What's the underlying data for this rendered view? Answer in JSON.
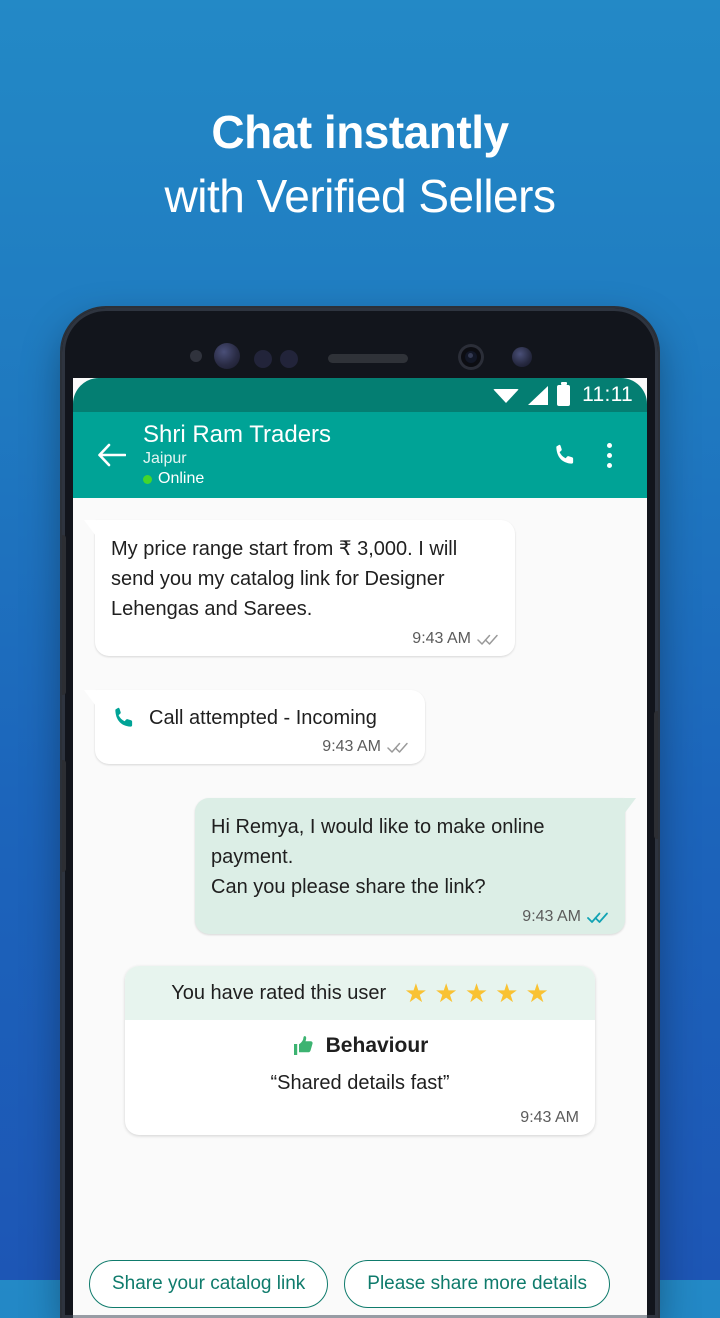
{
  "promo": {
    "headline_line1": "Chat instantly",
    "headline_line2": "with Verified Sellers",
    "background_top_color": "#2389c6",
    "background_bottom_color": "#1d56b5"
  },
  "phone": {
    "status_bar": {
      "time": "11:11",
      "icons": [
        "wifi-icon",
        "signal-icon",
        "battery-icon"
      ],
      "background_color": "#047e72"
    },
    "app_bar": {
      "back_icon": "arrow-left-icon",
      "contact_name": "Shri Ram Traders",
      "contact_location": "Jaipur",
      "presence_status": "Online",
      "presence_color": "#44d62c",
      "call_icon": "phone-icon",
      "overflow_icon": "more-vertical-icon",
      "background_color": "#00a396"
    },
    "chat": {
      "messages": [
        {
          "id": "msg-price-range",
          "direction": "incoming",
          "text": "My price range start from ₹ 3,000. I will send you my catalog link for Designer Lehengas and Sarees.",
          "time": "9:43 AM",
          "ticks": "double-check-delivered",
          "tick_color": "#9a9a9a"
        },
        {
          "id": "msg-call-attempted",
          "direction": "incoming",
          "type": "call-log",
          "icon": "phone-incoming-icon",
          "text": "Call attempted - Incoming",
          "time": "9:43 AM",
          "ticks": "double-check-delivered",
          "tick_color": "#9a9a9a"
        },
        {
          "id": "msg-online-payment",
          "direction": "outgoing",
          "text": "Hi Remya, I would like to make online payment.\nCan you please share the link?",
          "line1": "Hi Remya, I would like to make online payment.",
          "line2": "Can you please share the link?",
          "time": "9:43 AM",
          "ticks": "double-check-read",
          "tick_color": "#12a3b4"
        }
      ],
      "rating_card": {
        "header_text": "You have rated this user",
        "stars_filled": 5,
        "stars_total": 5,
        "star_glyph": "★",
        "star_color": "#f9c233",
        "thumb_icon": "thumbs-up-icon",
        "category_label": "Behaviour",
        "quote": "“Shared details fast”",
        "time": "9:43 AM"
      },
      "quick_replies": [
        {
          "id": "chip-share-catalog",
          "label": "Share your catalog link"
        },
        {
          "id": "chip-more-details",
          "label": "Please share more details"
        }
      ],
      "background_color": "#fafafa",
      "incoming_bubble_color": "#ffffff",
      "outgoing_bubble_color": "#dceee6"
    }
  }
}
